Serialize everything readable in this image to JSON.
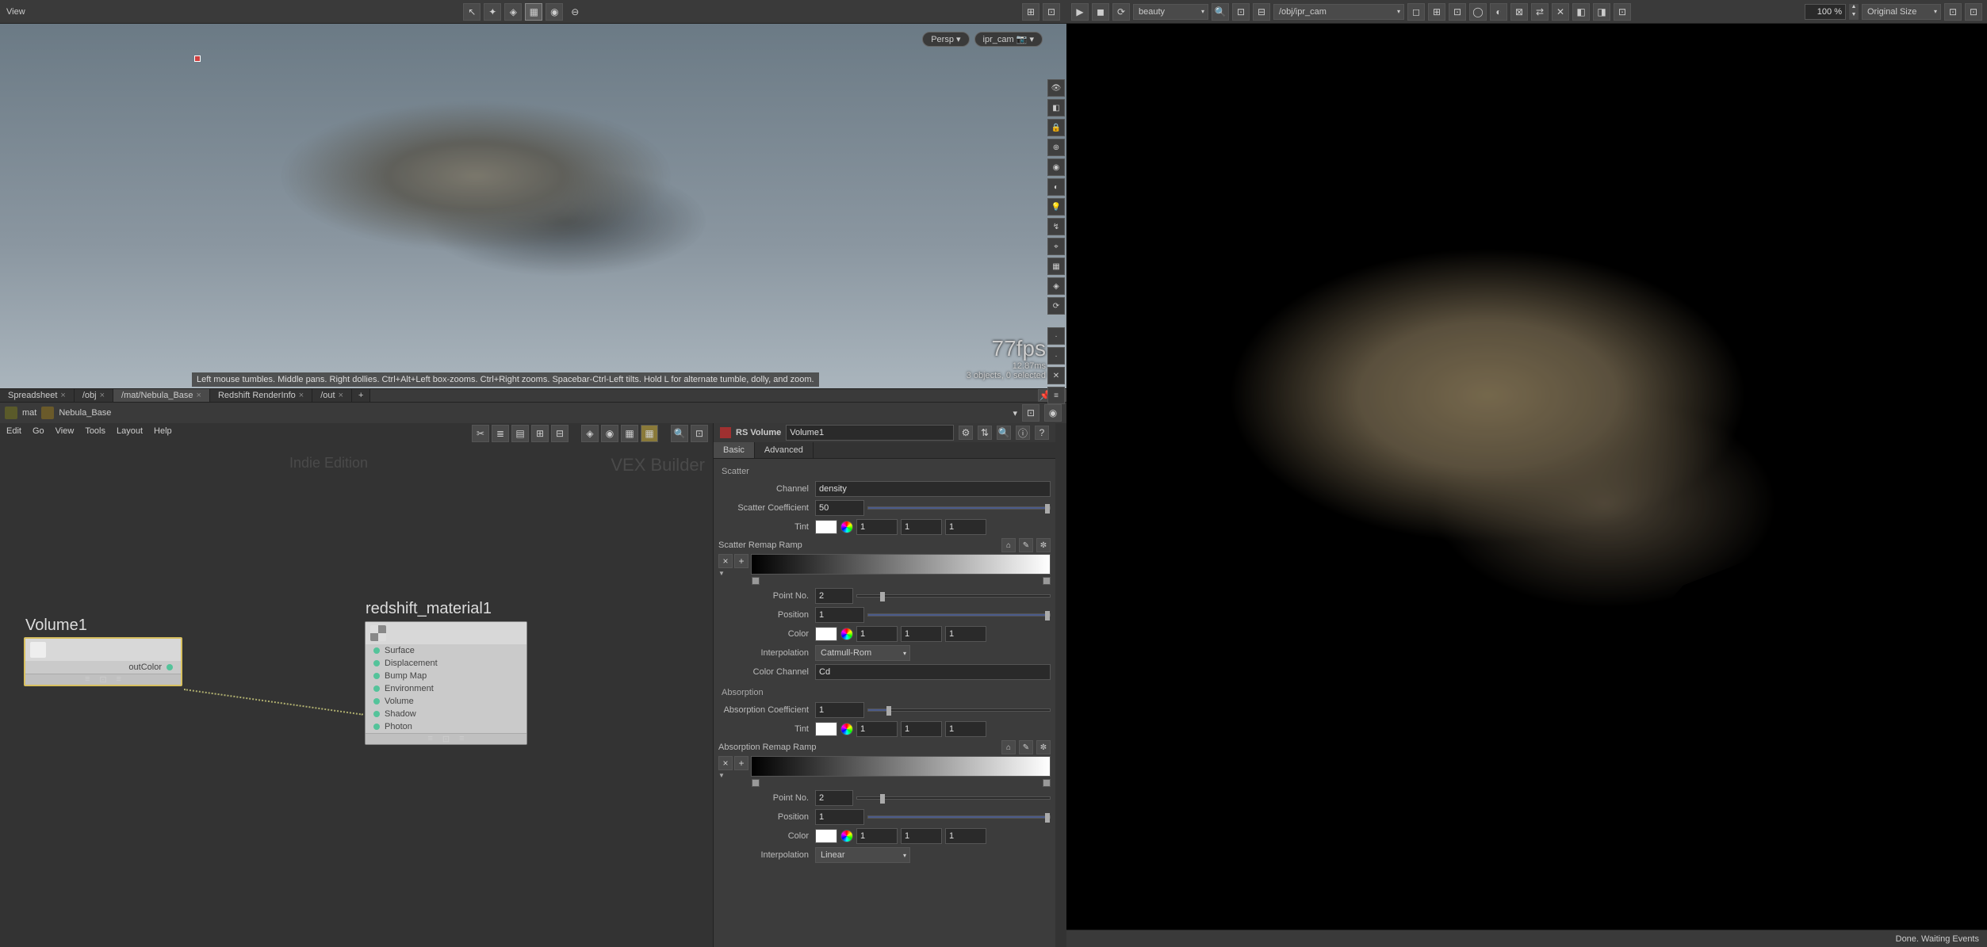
{
  "viewport": {
    "view_menu": "View",
    "persp_label": "Persp",
    "camera_label": "ipr_cam",
    "fps": "77fps",
    "frametime": "12.87ms",
    "object_info": "3 objects, 0 selected",
    "hint": "Left mouse tumbles. Middle pans. Right dollies. Ctrl+Alt+Left box-zooms. Ctrl+Right zooms. Spacebar-Ctrl-Left tilts. Hold L for alternate tumble, dolly, and zoom."
  },
  "tabs": [
    {
      "label": "Spreadsheet",
      "active": false
    },
    {
      "label": "/obj",
      "active": false
    },
    {
      "label": "/mat/Nebula_Base",
      "active": true
    },
    {
      "label": "Redshift RenderInfo",
      "active": false
    },
    {
      "label": "/out",
      "active": false
    }
  ],
  "breadcrumb": {
    "root": "mat",
    "current": "Nebula_Base"
  },
  "nodegraph": {
    "menu": [
      "Edit",
      "Go",
      "View",
      "Tools",
      "Layout",
      "Help"
    ],
    "watermark1": "Indie Edition",
    "watermark2": "VEX Builder",
    "node1": {
      "title": "Volume1",
      "output": "outColor"
    },
    "node2": {
      "title": "redshift_material1",
      "inputs": [
        "Surface",
        "Displacement",
        "Bump Map",
        "Environment",
        "Volume",
        "Shadow",
        "Photon"
      ]
    }
  },
  "params": {
    "type": "RS Volume",
    "name": "Volume1",
    "tab_basic": "Basic",
    "tab_advanced": "Advanced",
    "section_scatter": "Scatter",
    "section_scatter_ramp": "Scatter Remap Ramp",
    "section_absorption": "Absorption",
    "section_absorption_ramp": "Absorption Remap Ramp",
    "labels": {
      "channel": "Channel",
      "scatter_coeff": "Scatter Coefficient",
      "tint": "Tint",
      "point_no": "Point No.",
      "position": "Position",
      "color": "Color",
      "interpolation": "Interpolation",
      "color_channel": "Color Channel",
      "absorption_coeff": "Absorption Coefficient"
    },
    "scatter": {
      "channel": "density",
      "coefficient": "50",
      "tint": [
        "1",
        "1",
        "1"
      ],
      "point_no": "2",
      "position": "1",
      "color": [
        "1",
        "1",
        "1"
      ],
      "interpolation": "Catmull-Rom",
      "color_channel": "Cd"
    },
    "absorption": {
      "coefficient": "1",
      "tint": [
        "1",
        "1",
        "1"
      ],
      "point_no": "2",
      "position": "1",
      "color": [
        "1",
        "1",
        "1"
      ],
      "interpolation": "Linear"
    }
  },
  "render": {
    "aov": "beauty",
    "path": "/obj/ipr_cam",
    "zoom": "100 %",
    "size_mode": "Original Size",
    "status": "Done. Waiting Events"
  }
}
